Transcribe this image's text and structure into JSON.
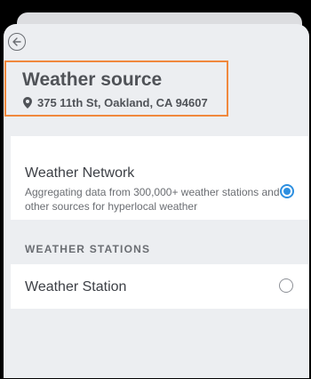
{
  "header": {
    "back_icon": "arrow-left-circle-icon",
    "title": "Weather source",
    "address_icon": "map-pin-icon",
    "address": "375 11th St, Oakland, CA 94607",
    "highlight_color": "#f0883d"
  },
  "options": [
    {
      "title": "Weather Network",
      "description": "Aggregating data from 300,000+ weather stations and other sources for hyperlocal weather",
      "selected": true
    }
  ],
  "section": {
    "label": "WEATHER STATIONS"
  },
  "stations": [
    {
      "title": "Weather Station",
      "selected": false
    }
  ],
  "colors": {
    "accent": "#2d8fe0",
    "background": "#eceef1"
  }
}
